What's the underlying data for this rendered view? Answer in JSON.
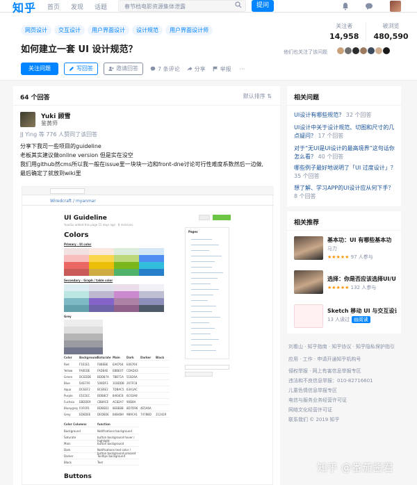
{
  "topbar": {
    "logo": "知乎",
    "nav": [
      "首页",
      "发现",
      "话题"
    ],
    "search_placeholder": "春节档电影资源集体泄露",
    "ask_label": "提问"
  },
  "question": {
    "tags": [
      "网页设计",
      "交互设计",
      "用户界面设计",
      "设计规范",
      "用户界面设计师"
    ],
    "title": "如何建立一套 UI 设计规范？",
    "followers_label": "关注者",
    "followers": "14,958",
    "views_label": "被浏览",
    "views": "480,590",
    "followed_by_text": "他们也关注了该问题",
    "actions": {
      "follow": "关注问题",
      "write": "写回答",
      "invite": "邀请回答",
      "comments": "7 条评论",
      "share": "分享",
      "report": "举报",
      "more": "···"
    }
  },
  "answers": {
    "count_label": "64 个回答",
    "sort_label": "默认排序",
    "author": "Yuki 顾雪",
    "author_tag": "鉴黄师",
    "upvote_text": "JJ Ying 等 776 人赞同了该回答",
    "lines": [
      "分享下我司一些项目的guideline",
      "老板其实建议做online version 但是实在没空",
      "我们用github然cms所以我一般在issue里一块块一边和front-dne讨论可行性难度系数然后一边做,",
      "最后确定了就放到wiki里"
    ],
    "screenshot": {
      "repo": "Wiredcraft / myanmar",
      "title": "UI Guideline",
      "subtitle": "YuanSu added this page 15 days ago · 8 revisions",
      "colors_heading": "Colors",
      "primary_label": "Primary - UI color",
      "secondary_label": "Secondary - Graph / table color",
      "grey_label": "Grey",
      "pages_label": "Pages",
      "table_headers": [
        "Color",
        "Background",
        "Saturate",
        "Main",
        "Dark",
        "Darker",
        "Black"
      ],
      "table_rows": [
        [
          "Red",
          "F1E1E1",
          "F8BEBE",
          "EA6764",
          "E06764",
          "",
          ""
        ],
        [
          "Yellow",
          "FAEEDE",
          "FAD64E",
          "EBBE07",
          "CDAD43",
          "",
          ""
        ],
        [
          "Green",
          "DCEDDE",
          "BDD87A",
          "7BB71A",
          "51B26A",
          "",
          ""
        ],
        [
          "Blue",
          "D4E7F6",
          "508DF3",
          "31BDDB",
          "267FC8",
          "",
          ""
        ],
        [
          "Aqua",
          "DCEEF2",
          "BCE6E2",
          "7DBAC5",
          "63A1AC",
          "",
          ""
        ],
        [
          "Purple",
          "E1E1EC",
          "BDB8CF",
          "8464C8",
          "6C63A8",
          "",
          ""
        ],
        [
          "Fuchsia",
          "EBDDE9",
          "CB8ACE",
          "AC82A7",
          "90D8A",
          "",
          ""
        ],
        [
          "Blueygrey",
          "F0F0F6",
          "BDBED1",
          "8E8EBB",
          "8D7D96",
          "4E5A6A",
          ""
        ],
        [
          "Grey",
          "EDEDEE",
          "DEDEDE",
          "B4B4B4",
          "9B9CA1",
          "74788D",
          "212429"
        ]
      ],
      "columns_headers": [
        "Color Columns",
        "function"
      ],
      "columns_rows": [
        [
          "Background",
          "Notifications background"
        ],
        [
          "Saturate",
          "button background hover / highlight"
        ],
        [
          "Main",
          "button background"
        ],
        [
          "Dark",
          "Notifications text color / button background pressed"
        ],
        [
          "Darker",
          "Tooltips background"
        ],
        [
          "Black",
          "Text"
        ]
      ],
      "buttons_heading": "Buttons"
    }
  },
  "related": {
    "title": "相关问题",
    "items": [
      {
        "text": "UI设计有哪些规范？",
        "count": "32 个回答"
      },
      {
        "text": "UI设计中关于设计规范、切图和尺寸的几点疑问？",
        "count": "17 个回答"
      },
      {
        "text": "对于“无UI是UI设计的最高境界”这句话你怎么看？",
        "count": "40 个回答"
      },
      {
        "text": "哪些例子最好地说明了「UI 过度设计」？",
        "count": "35 个回答"
      },
      {
        "text": "想了解、学习APP的UI设计应从何下手？",
        "count": "8 个回答"
      }
    ]
  },
  "recommend": {
    "title": "相关推荐",
    "items": [
      {
        "title": "基本功：UI 有哪些基本功",
        "sub": "马力",
        "meta": "97 人参与",
        "stars": "★★★★★"
      },
      {
        "title": "选择：你是否应该选择UI/U",
        "sub": "★★★★★",
        "meta": "132 人参与",
        "stars": "★★★★★"
      },
      {
        "title": "Sketch 移动 UI 与交互设计",
        "sub": "13 人读过",
        "meta": "阅读",
        "stars": ""
      }
    ]
  },
  "footer": {
    "lines": [
      "刘看山 · 知乎指南 · 知乎协议 · 知乎隐私保护指引",
      "应用 · 工作 · 申请开通知乎机构号",
      "侵权举报 · 网上有害信息举报专区",
      "违法和不良信息举报：010-82716601",
      "儿童色情信息举报专区",
      "电信与服务业务经营许可证",
      "网络文化经营许可证",
      "联系我们 © 2019 知乎"
    ]
  },
  "watermark": "知乎 @番茄酱君"
}
